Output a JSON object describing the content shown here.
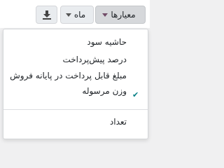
{
  "toolbar": {
    "measures_label": "معیارها",
    "month_label": "ماه",
    "download_icon": "download-icon"
  },
  "measures_menu": {
    "items": [
      {
        "label": "حاشیه سود",
        "checked": false
      },
      {
        "label": "درصد پیش‌پرداخت",
        "checked": false
      },
      {
        "label": "مبلغ قابل پرداخت در پایانه فروش",
        "checked": false
      },
      {
        "label": "وزن مرسوله",
        "checked": false
      }
    ],
    "count": {
      "label": "تعداد",
      "checked": true
    }
  },
  "colors": {
    "accent": "#714b67",
    "check": "#017e84"
  }
}
